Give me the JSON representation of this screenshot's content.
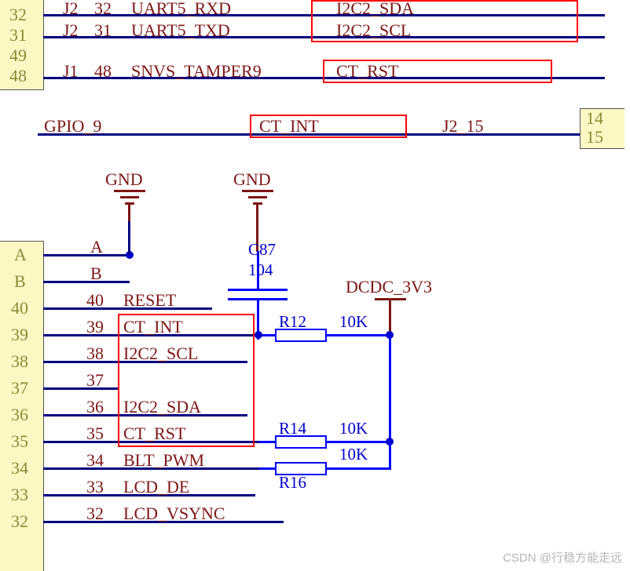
{
  "top_block": {
    "pins_left": [
      "32",
      "31",
      "49",
      "48"
    ],
    "rows": [
      {
        "ref": "J2",
        "num": "32",
        "sig": "UART5_RXD",
        "alt": "I2C2_SDA"
      },
      {
        "ref": "J2",
        "num": "31",
        "sig": "UART5_TXD",
        "alt": "I2C2_SCL"
      },
      {
        "ref": "J1",
        "num": "48",
        "sig": "SNVS_TAMPER9",
        "alt": "CT_RST"
      }
    ],
    "gpio_row": {
      "left": "GPIO_9",
      "mid": "CT_INT",
      "right": "J2_15",
      "pins_right": [
        "14",
        "15"
      ]
    }
  },
  "gnd_label": "GND",
  "power_label": "DCDC_3V3",
  "cap": {
    "ref": "C87",
    "val": "104"
  },
  "res": [
    {
      "ref": "R12",
      "val": "10K"
    },
    {
      "ref": "R14",
      "val": "10K"
    },
    {
      "ref": "R16",
      "val": "10K"
    }
  ],
  "connector": {
    "pins_left": [
      "A",
      "B",
      "40",
      "39",
      "38",
      "37",
      "36",
      "35",
      "34",
      "33",
      "32"
    ],
    "rows": [
      {
        "p": "A",
        "sig": ""
      },
      {
        "p": "B",
        "sig": ""
      },
      {
        "p": "40",
        "sig": "RESET"
      },
      {
        "p": "39",
        "sig": "CT_INT"
      },
      {
        "p": "38",
        "sig": "I2C2_SCL"
      },
      {
        "p": "37",
        "sig": ""
      },
      {
        "p": "36",
        "sig": "I2C2_SDA"
      },
      {
        "p": "35",
        "sig": "CT_RST"
      },
      {
        "p": "34",
        "sig": "BLT_PWM"
      },
      {
        "p": "33",
        "sig": "LCD_DE"
      },
      {
        "p": "32",
        "sig": "LCD_VSYNC"
      }
    ]
  },
  "watermark": "CSDN @行稳方能走远"
}
